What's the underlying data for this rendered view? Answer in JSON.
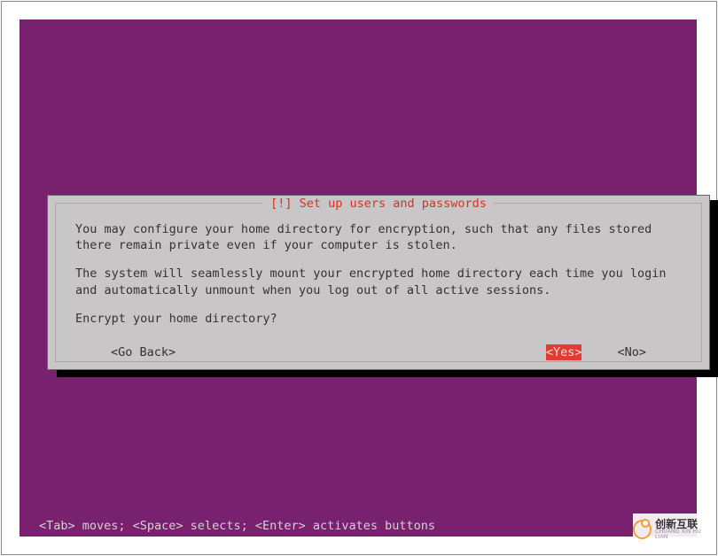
{
  "dialog": {
    "title": "[!] Set up users and passwords",
    "paragraph1": "You may configure your home directory for encryption, such that any files stored there remain private even if your computer is stolen.",
    "paragraph2": "The system will seamlessly mount your encrypted home directory each time you login and automatically unmount when you log out of all active sessions.",
    "question": "Encrypt your home directory?",
    "buttons": {
      "go_back": "<Go Back>",
      "yes": "<Yes>",
      "no": "<No>"
    }
  },
  "footer": "<Tab> moves; <Space> selects; <Enter> activates buttons",
  "watermark": {
    "cn": "创新互联",
    "en": "CHUANG XIN HU LIAN"
  },
  "colors": {
    "background": "#77216F",
    "dialog_bg": "#c8c6c6",
    "title_color": "#d93025",
    "selected_bg": "#e53a2f"
  }
}
